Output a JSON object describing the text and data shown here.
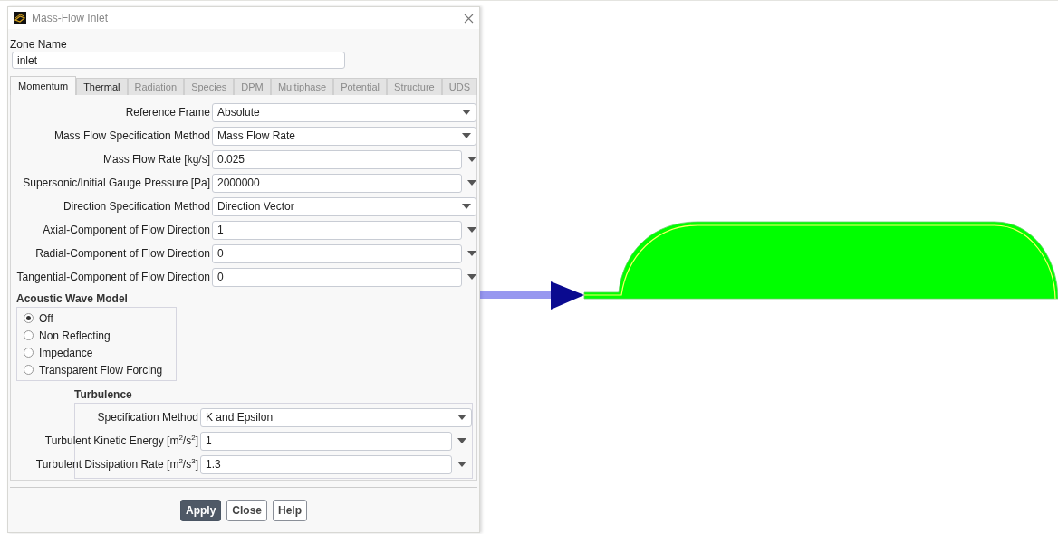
{
  "window": {
    "title": "Mass-Flow Inlet"
  },
  "zone_name": {
    "label": "Zone Name",
    "value": "inlet"
  },
  "tabs": [
    {
      "label": "Momentum",
      "selected": true,
      "disabled": false
    },
    {
      "label": "Thermal",
      "selected": false,
      "disabled": false
    },
    {
      "label": "Radiation",
      "selected": false,
      "disabled": true
    },
    {
      "label": "Species",
      "selected": false,
      "disabled": true
    },
    {
      "label": "DPM",
      "selected": false,
      "disabled": true
    },
    {
      "label": "Multiphase",
      "selected": false,
      "disabled": true
    },
    {
      "label": "Potential",
      "selected": false,
      "disabled": true
    },
    {
      "label": "Structure",
      "selected": false,
      "disabled": true
    },
    {
      "label": "UDS",
      "selected": false,
      "disabled": true
    }
  ],
  "fields": [
    {
      "kind": "dropdown",
      "label": "Reference Frame",
      "value": "Absolute"
    },
    {
      "kind": "dropdown",
      "label": "Mass Flow Specification Method",
      "value": "Mass Flow Rate"
    },
    {
      "kind": "number",
      "label": "Mass Flow Rate [kg/s]",
      "value": "0.025"
    },
    {
      "kind": "number",
      "label": "Supersonic/Initial Gauge Pressure [Pa]",
      "value": "2000000"
    },
    {
      "kind": "dropdown",
      "label": "Direction Specification Method",
      "value": "Direction Vector"
    },
    {
      "kind": "number",
      "label": "Axial-Component of Flow Direction",
      "value": "1"
    },
    {
      "kind": "number",
      "label": "Radial-Component of Flow Direction",
      "value": "0"
    },
    {
      "kind": "number",
      "label": "Tangential-Component of Flow Direction",
      "value": "0"
    }
  ],
  "acoustic_wave_model": {
    "title": "Acoustic Wave Model",
    "options": [
      {
        "label": "Off",
        "selected": true
      },
      {
        "label": "Non Reflecting",
        "selected": false
      },
      {
        "label": "Impedance",
        "selected": false
      },
      {
        "label": "Transparent Flow Forcing",
        "selected": false
      }
    ]
  },
  "turbulence": {
    "title": "Turbulence",
    "fields": [
      {
        "kind": "dropdown",
        "label": "Specification Method",
        "value": "K and Epsilon"
      },
      {
        "kind": "number",
        "label": "Turbulent Kinetic Energy [m$^{2}$/s$^{2}$]",
        "value": "1"
      },
      {
        "kind": "number",
        "label": "Turbulent Dissipation Rate [m$^{2}$/s$^{3}$]",
        "value": "1.3"
      }
    ]
  },
  "buttons": [
    {
      "label": "Apply",
      "kind": "primary"
    },
    {
      "label": "Close",
      "kind": "default"
    },
    {
      "label": "Help",
      "kind": "default"
    }
  ]
}
